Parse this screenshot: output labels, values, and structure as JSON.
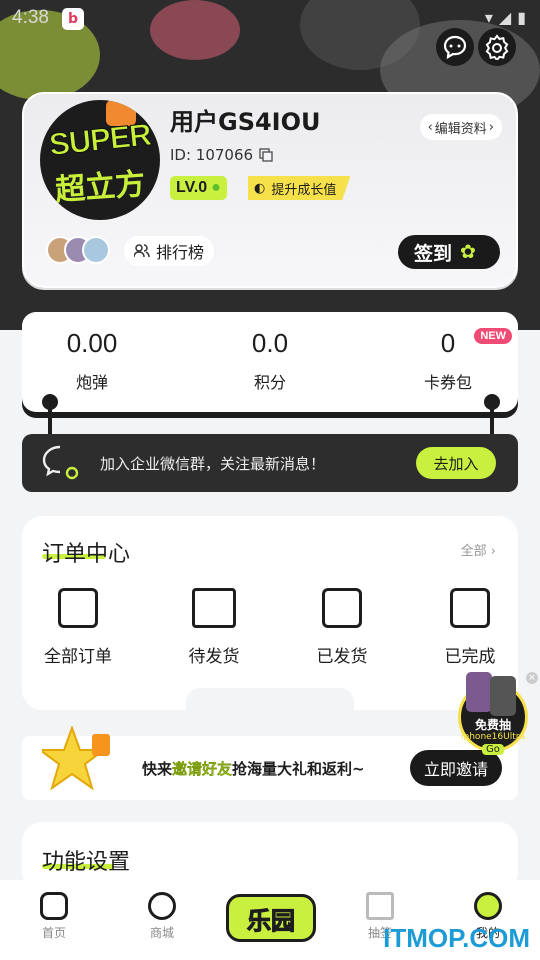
{
  "status": {
    "time": "4:38"
  },
  "profile": {
    "avatar_line1": "SUPER",
    "avatar_line2": "超立方",
    "username": "用户GS4IOU",
    "edit_label": "编辑资料",
    "id_label": "ID: 107066",
    "level": "LV.0",
    "grow_label": "提升成长值",
    "rank_label": "排行榜",
    "signin_label": "签到"
  },
  "stats": [
    {
      "value": "0.00",
      "label": "炮弹"
    },
    {
      "value": "0.0",
      "label": "积分"
    },
    {
      "value": "0",
      "label": "卡券包"
    }
  ],
  "new_badge": "NEW",
  "wechat": {
    "text": "加入企业微信群，关注最新消息！",
    "button": "去加入"
  },
  "orders": {
    "title": "订单中心",
    "all": "全部",
    "items": [
      "全部订单",
      "待发货",
      "已发货",
      "已完成"
    ]
  },
  "invite": {
    "text_pre": "快来",
    "text_hl": "邀请好友",
    "text_post": "抢海量大礼和返利~",
    "button": "立即邀请"
  },
  "promo": {
    "line1": "免费抽",
    "line2": "iphone16Ultra",
    "line3": "Go"
  },
  "settings": {
    "title": "功能设置"
  },
  "tabs": {
    "home": "首页",
    "mall": "商城",
    "center": "乐园",
    "draw": "抽签",
    "mine": "我的"
  },
  "watermark": "ITMOP.COM"
}
